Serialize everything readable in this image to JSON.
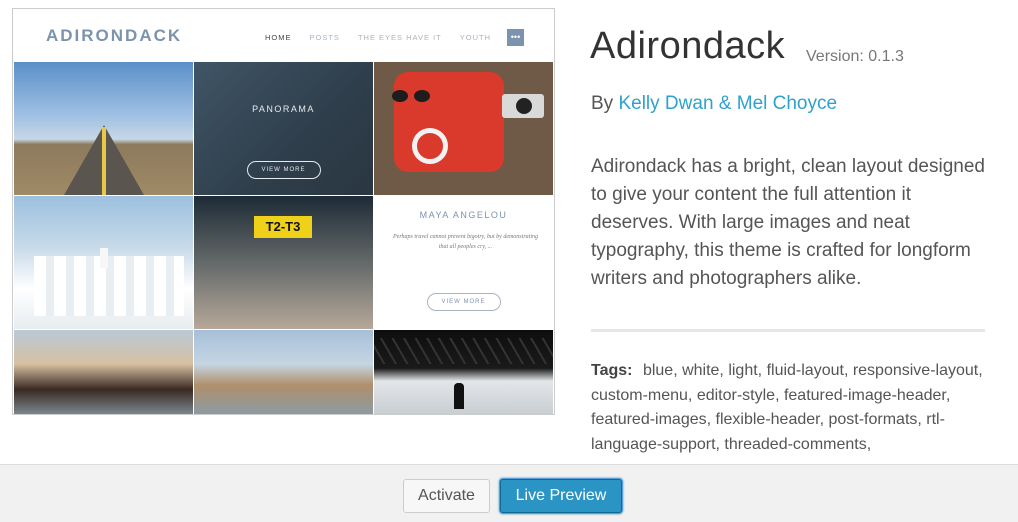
{
  "preview": {
    "site_logo": "ADIRONDACK",
    "nav": [
      "HOME",
      "POSTS",
      "THE EYES HAVE IT",
      "YOUTH"
    ],
    "menu_icon": "menu-icon",
    "tiles": {
      "panorama_title": "PANORAMA",
      "panorama_button": "VIEW MORE",
      "signage": "T2-T3",
      "quote_title": "MAYA ANGELOU",
      "quote_text": "Perhaps travel cannot prevent bigotry, but by demonstrating that all peoples cry, ...",
      "quote_button": "VIEW MORE"
    }
  },
  "theme": {
    "name": "Adirondack",
    "version": "Version: 0.1.3",
    "by_label": "By",
    "author": "Kelly Dwan & Mel Choyce",
    "description": "Adirondack has a bright, clean layout designed to give your content the full attention it deserves. With large images and neat typography, this theme is crafted for longform writers and photographers alike.",
    "tags_label": "Tags:",
    "tags": "blue, white, light, fluid-layout, responsive-layout, custom-menu, editor-style, featured-image-header, featured-images, flexible-header, post-formats, rtl-language-support, threaded-comments,"
  },
  "actions": {
    "activate": "Activate",
    "live_preview": "Live Preview"
  },
  "colors": {
    "link": "#2ea2cc",
    "primary_button": "#2a95c5",
    "logo": "#7b93ad"
  }
}
